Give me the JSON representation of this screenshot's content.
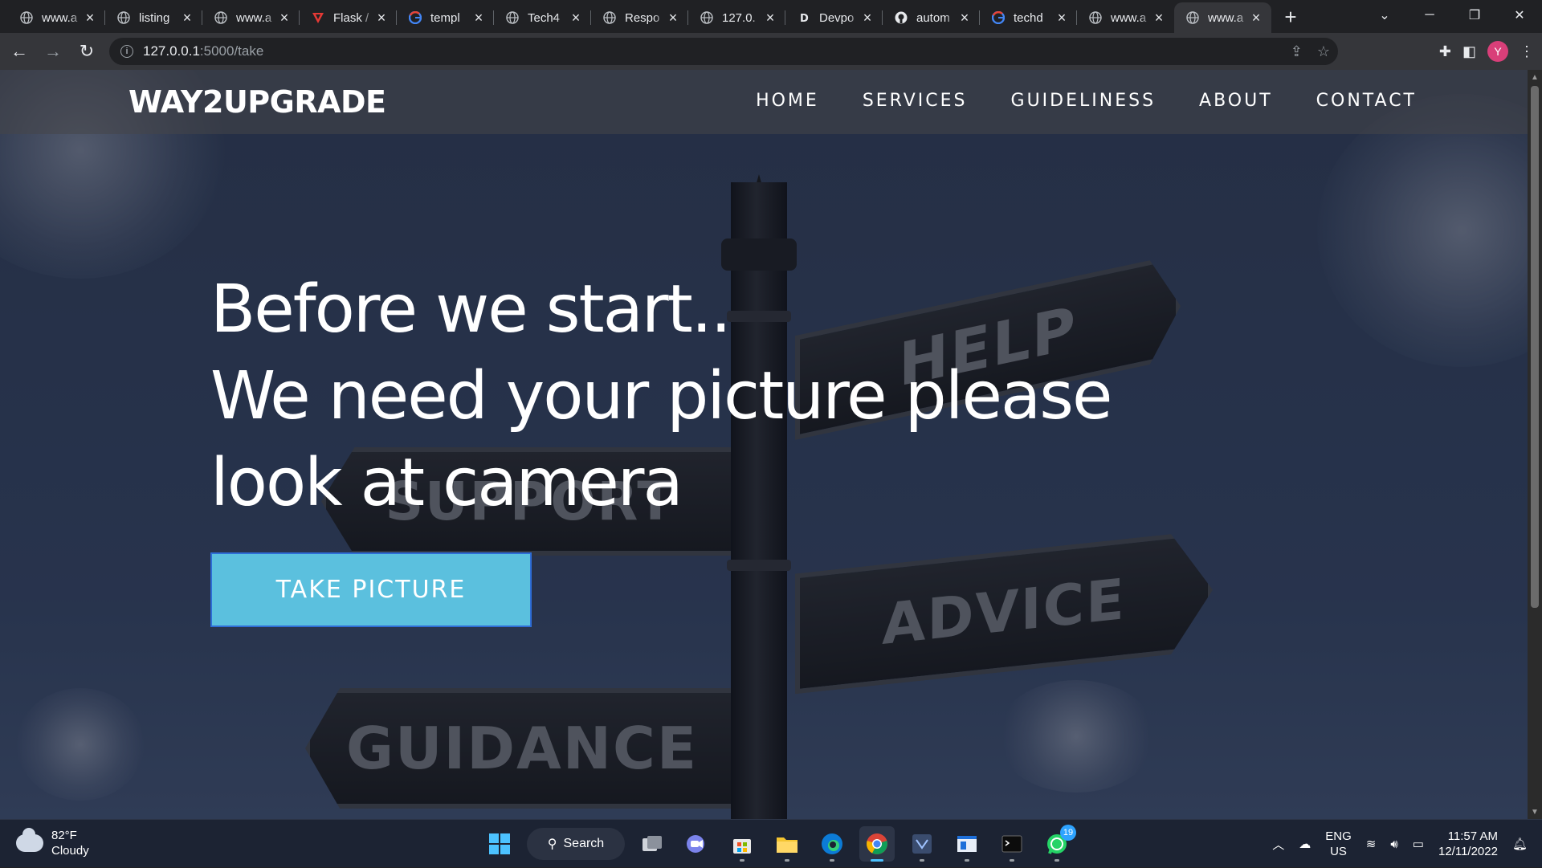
{
  "browser": {
    "tabs": [
      {
        "title": "www.a",
        "favicon": "globe-icon"
      },
      {
        "title": "listing",
        "favicon": "globe-icon"
      },
      {
        "title": "www.a",
        "favicon": "globe-icon"
      },
      {
        "title": "Flask /",
        "favicon": "flask-v-icon"
      },
      {
        "title": "templ",
        "favicon": "google-icon"
      },
      {
        "title": "Tech4",
        "favicon": "globe-icon"
      },
      {
        "title": "Respo",
        "favicon": "globe-icon"
      },
      {
        "title": "127.0.",
        "favicon": "globe-icon"
      },
      {
        "title": "Devpo",
        "favicon": "devpost-d-icon"
      },
      {
        "title": "autom",
        "favicon": "github-icon"
      },
      {
        "title": "techd",
        "favicon": "google-icon"
      },
      {
        "title": "www.a",
        "favicon": "globe-icon"
      },
      {
        "title": "www.a",
        "favicon": "globe-icon"
      }
    ],
    "active_tab_index": 12,
    "url_host": "127.0.0.1",
    "url_path": ":5000/take",
    "profile_initial": "Y"
  },
  "site": {
    "brand": "WAY2UPGRADE",
    "nav": [
      "HOME",
      "SERVICES",
      "GUIDELINESS",
      "ABOUT",
      "CONTACT"
    ],
    "hero_lines": [
      "Before we start..",
      "We need your picture please",
      "look at camera"
    ],
    "cta_label": "TAKE PICTURE",
    "sign_words": [
      "HELP",
      "SUPPORT",
      "ADVICE",
      "GUIDANCE"
    ]
  },
  "taskbar": {
    "weather_temp": "82°F",
    "weather_desc": "Cloudy",
    "search_label": "Search",
    "whatsapp_badge": "19",
    "lang_top": "ENG",
    "lang_bottom": "US",
    "time": "11:57 AM",
    "date": "12/11/2022"
  }
}
